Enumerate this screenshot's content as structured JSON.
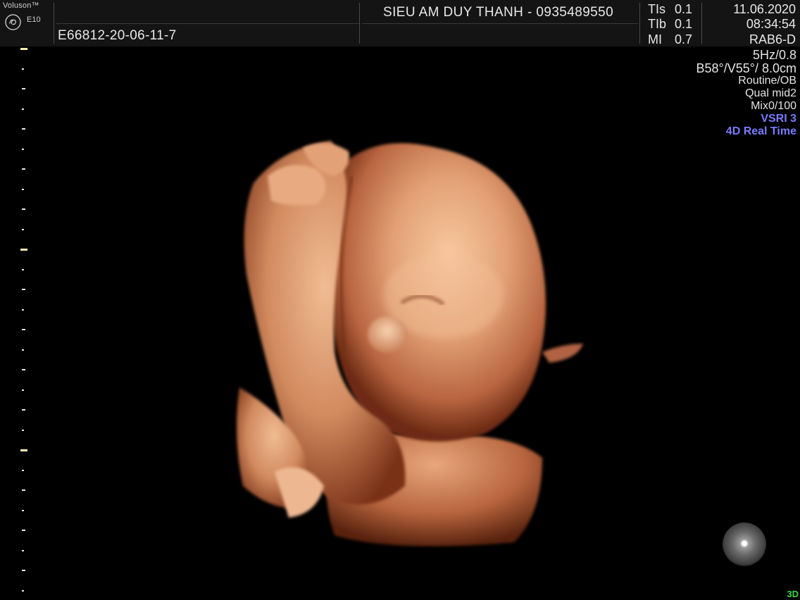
{
  "header": {
    "brand": "Voluson™",
    "model": "E10",
    "logo_icon": "ge-logo",
    "patient_id": "E66812-20-06-11-7",
    "clinic": "SIEU AM DUY THANH - 0935489550",
    "indices": [
      {
        "label": "TIs",
        "value": "0.1"
      },
      {
        "label": "TIb",
        "value": "0.1"
      },
      {
        "label": "MI",
        "value": "0.7"
      }
    ],
    "date": "11.06.2020",
    "time": "08:34:54",
    "probe": "RAB6-D"
  },
  "info_panel": {
    "frequency": "5Hz/0.8",
    "angles": "B58°/V55°/ 8.0cm",
    "preset": "Routine/OB",
    "quality": "Qual mid2",
    "mix": "Mix0/100",
    "vsri": "VSRI 3",
    "mode": "4D Real Time"
  },
  "footer": {
    "render_mode": "3D"
  },
  "colors": {
    "background": "#000000",
    "header_bg": "#141414",
    "text": "#e8e8e8",
    "accent_blue": "#7b7bff",
    "ruler_major": "#f2f2b0",
    "mode_green": "#39d64b",
    "skin_tone": "#d9946a"
  }
}
